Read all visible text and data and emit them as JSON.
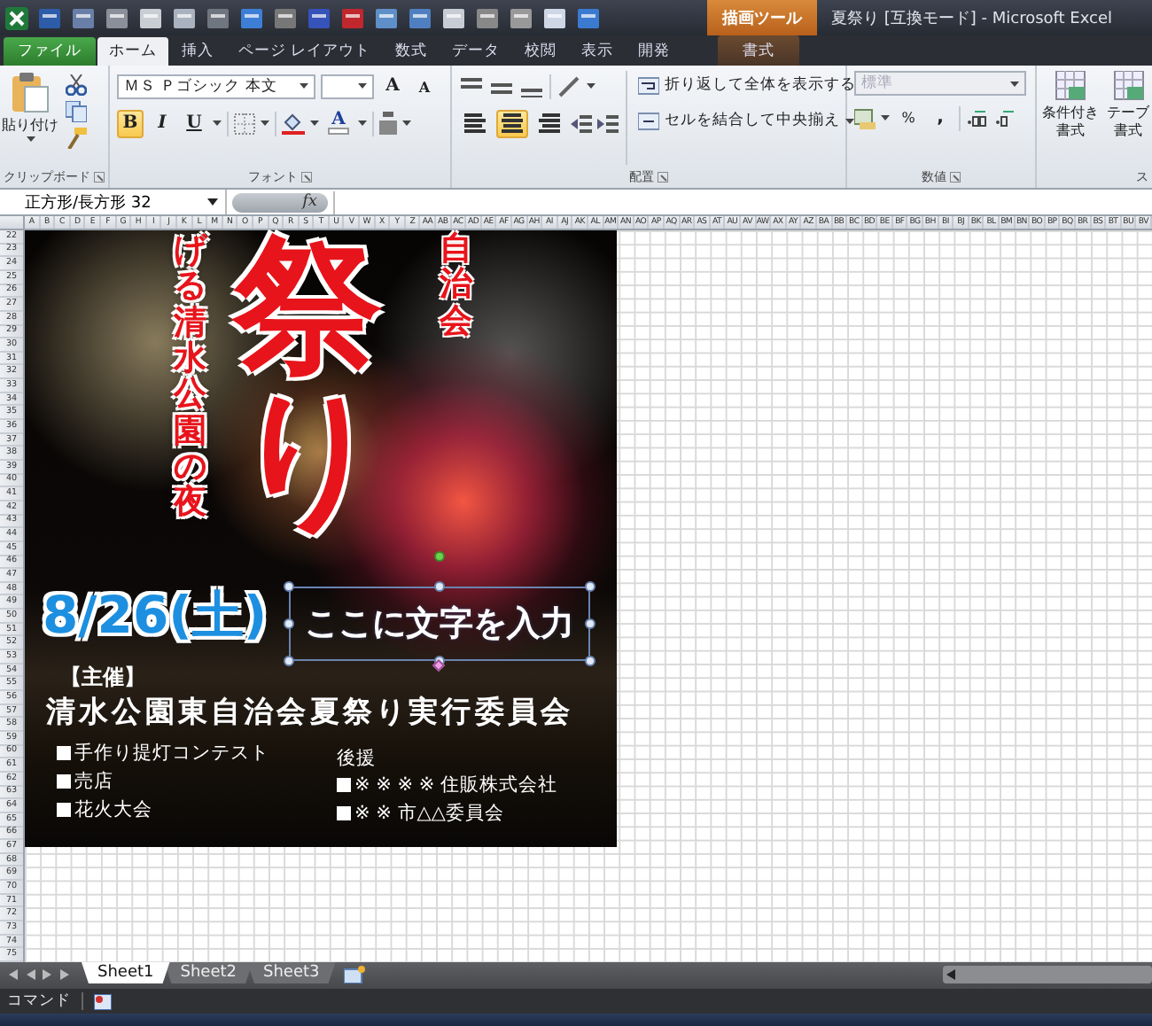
{
  "window": {
    "title": "夏祭り [互換モード] - Microsoft Excel",
    "context_group": "描画ツール"
  },
  "tabs": [
    {
      "label": "ファイル",
      "kind": "file",
      "selected": false
    },
    {
      "label": "ホーム",
      "kind": "normal",
      "selected": true
    },
    {
      "label": "挿入",
      "kind": "normal",
      "selected": false
    },
    {
      "label": "ページ レイアウト",
      "kind": "normal",
      "selected": false
    },
    {
      "label": "数式",
      "kind": "normal",
      "selected": false
    },
    {
      "label": "データ",
      "kind": "normal",
      "selected": false
    },
    {
      "label": "校閲",
      "kind": "normal",
      "selected": false
    },
    {
      "label": "表示",
      "kind": "normal",
      "selected": false
    },
    {
      "label": "開発",
      "kind": "normal",
      "selected": false
    },
    {
      "label": "書式",
      "kind": "contextual",
      "selected": false
    }
  ],
  "ribbon": {
    "clipboard": {
      "paste": "貼り付け",
      "group_label": "クリップボード"
    },
    "font": {
      "font_name": "ＭＳ Ｐゴシック 本文",
      "grow": "A",
      "shrink": "A",
      "bold": {
        "label": "B",
        "on": true
      },
      "italic": {
        "label": "I",
        "on": false
      },
      "underline": {
        "label": "U",
        "on": false
      },
      "font_color": "A",
      "group_label": "フォント"
    },
    "alignment": {
      "align": [
        {
          "selected": false
        },
        {
          "selected": true
        },
        {
          "selected": false
        }
      ],
      "wrap_text": "折り返して全体を表示する",
      "merge_center": "セルを結合して中央揃え",
      "group_label": "配置"
    },
    "number": {
      "format": {
        "value": "標準",
        "disabled": true
      },
      "percent": "%",
      "comma": ",",
      "group_label": "数値"
    },
    "styles": {
      "buttons": [
        {
          "lines": [
            "条件付き",
            "書式"
          ]
        },
        {
          "lines": [
            "テーブ",
            "書式"
          ]
        }
      ],
      "group_label": "ス"
    }
  },
  "formula_bar": {
    "name_box": "正方形/長方形 32",
    "function_button": "fx"
  },
  "columns": [
    "A",
    "B",
    "C",
    "D",
    "E",
    "F",
    "G",
    "H",
    "I",
    "J",
    "K",
    "L",
    "M",
    "N",
    "O",
    "P",
    "Q",
    "R",
    "S",
    "T",
    "U",
    "V",
    "W",
    "X",
    "Y",
    "Z",
    "AA",
    "AB",
    "AC",
    "AD",
    "AE",
    "AF",
    "AG",
    "AH",
    "AI",
    "AJ",
    "AK",
    "AL",
    "AM",
    "AN",
    "AO",
    "AP",
    "AQ",
    "AR",
    "AS",
    "AT",
    "AU",
    "AV",
    "AW",
    "AX",
    "AY",
    "AZ",
    "BA",
    "BB",
    "BC",
    "BD",
    "BE",
    "BF",
    "BG",
    "BH",
    "BI",
    "BJ",
    "BK",
    "BL",
    "BM",
    "BN",
    "BO",
    "BP",
    "BQ",
    "BR",
    "BS",
    "BT",
    "BU",
    "BV"
  ],
  "rows": [
    "22",
    "23",
    "24",
    "25",
    "26",
    "27",
    "28",
    "29",
    "30",
    "31",
    "32",
    "33",
    "34",
    "35",
    "36",
    "37",
    "38",
    "39",
    "40",
    "41",
    "42",
    "43",
    "44",
    "45",
    "46",
    "47",
    "48",
    "49",
    "50",
    "51",
    "52",
    "53",
    "54",
    "55",
    "56",
    "57",
    "58",
    "59",
    "60",
    "61",
    "62",
    "63",
    "64",
    "65",
    "66",
    "67",
    "68",
    "69",
    "70",
    "71",
    "72",
    "73",
    "74",
    "75"
  ],
  "poster": {
    "title": "祭り",
    "subtitle": "げる清水公園の夜",
    "organizer_short": "自治会",
    "date": "8/26(土)",
    "selected_textbox": "ここに文字を入力",
    "host_label": "【主催】",
    "host": "清水公園東自治会夏祭り実行委員会",
    "events": [
      "手作り提灯コンテスト",
      "売店",
      "花火大会"
    ],
    "sponsor_label": "後援",
    "sponsors": [
      "※ ※ ※ ※ 住販株式会社",
      "※ ※ 市△△委員会"
    ]
  },
  "sheets": [
    {
      "label": "Sheet1",
      "selected": true
    },
    {
      "label": "Sheet2",
      "selected": false
    },
    {
      "label": "Sheet3",
      "selected": false
    }
  ],
  "status_bar": {
    "mode": "コマンド"
  }
}
